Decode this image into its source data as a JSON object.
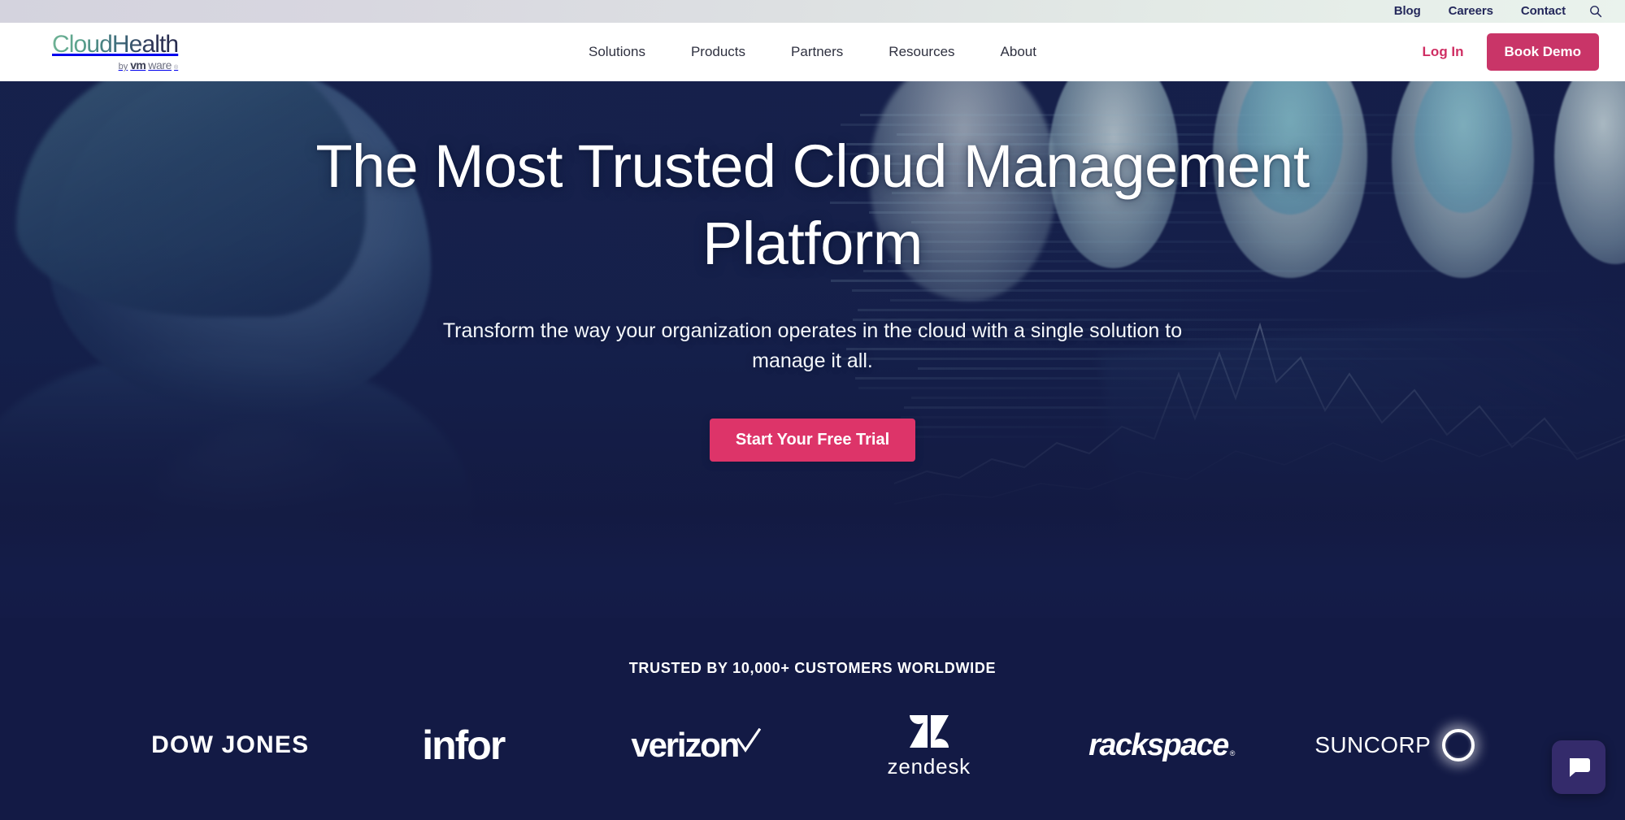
{
  "utility_bar": {
    "links": [
      {
        "label": "Blog"
      },
      {
        "label": "Careers"
      },
      {
        "label": "Contact"
      }
    ],
    "search_icon": "search-icon"
  },
  "header": {
    "logo": {
      "cloud": "Cloud",
      "health": "Health",
      "by": "by",
      "vm": "vm",
      "ware": "ware",
      "registered": "®"
    },
    "nav": [
      {
        "label": "Solutions"
      },
      {
        "label": "Products"
      },
      {
        "label": "Partners"
      },
      {
        "label": "Resources"
      },
      {
        "label": "About"
      }
    ],
    "login_label": "Log In",
    "demo_label": "Book Demo"
  },
  "hero": {
    "title": "The Most Trusted Cloud Management Platform",
    "subtitle": "Transform the way your organization operates in the cloud with a single solution to manage it all.",
    "cta_label": "Start Your Free Trial"
  },
  "trusted": {
    "title": "TRUSTED BY 10,000+ CUSTOMERS WORLDWIDE",
    "logos": [
      {
        "name": "dow-jones",
        "text": "DOW JONES"
      },
      {
        "name": "infor",
        "text": "infor"
      },
      {
        "name": "verizon",
        "text": "verizon"
      },
      {
        "name": "zendesk",
        "text": "zendesk"
      },
      {
        "name": "rackspace",
        "text": "rackspace",
        "mark": "®"
      },
      {
        "name": "suncorp",
        "text": "SUNCORP"
      }
    ]
  },
  "chat": {
    "icon": "chat-bubble-icon"
  },
  "colors": {
    "brand_pink": "#c93568",
    "cta_pink": "#dd3469",
    "login_pink": "#cf2e63",
    "navy": "#131a45",
    "logo_green": "#6fb295",
    "logo_navy": "#262a4d",
    "chat_purple": "#342b6b",
    "utility_text": "#24285b"
  }
}
